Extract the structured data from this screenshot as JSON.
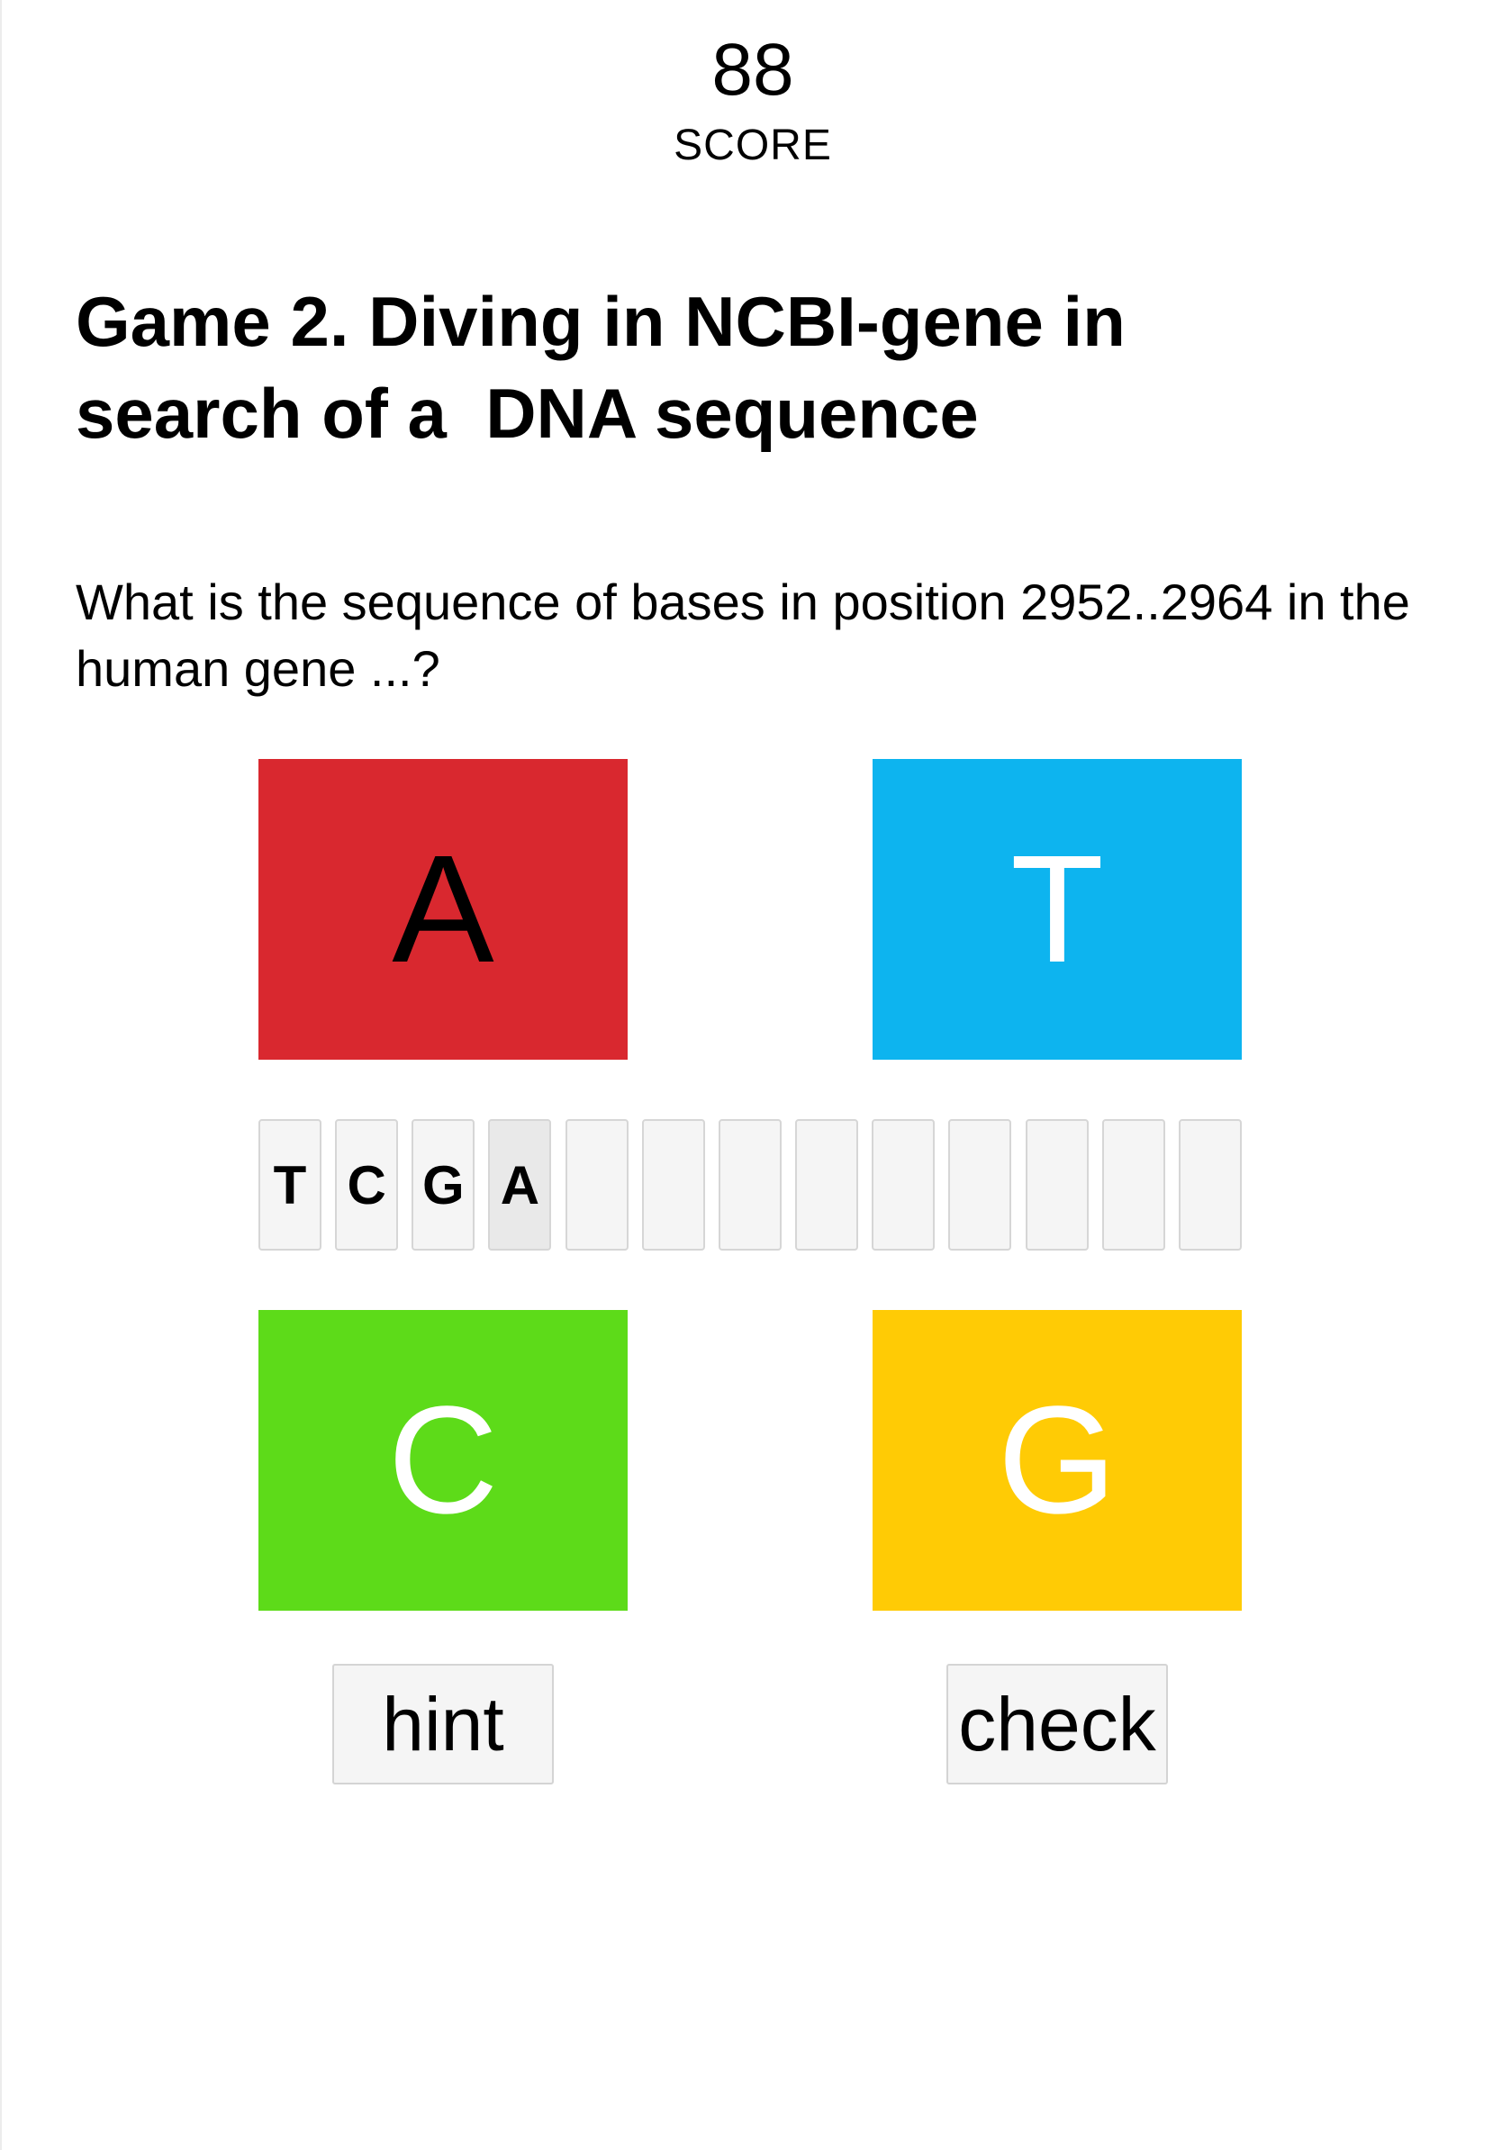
{
  "score": {
    "value": "88",
    "label": "SCORE"
  },
  "title": "Game 2. Diving in NCBI-gene in\nsearch of a  DNA sequence",
  "question": "What is the sequence of bases in position 2952..2964 in the human gene ...?",
  "tiles": [
    {
      "base": "A",
      "color": "#d9282f",
      "text_color": "#000000"
    },
    {
      "base": "T",
      "color": "#0db4ef",
      "text_color": "#ffffff"
    },
    {
      "base": "C",
      "color": "#5ddb19",
      "text_color": "#ffffff"
    },
    {
      "base": "G",
      "color": "#ffcb05",
      "text_color": "#ffffff"
    }
  ],
  "sequence": {
    "length": 13,
    "entered": [
      "T",
      "C",
      "G",
      "A"
    ],
    "active_index": 3
  },
  "buttons": {
    "hint": "hint",
    "check": "check"
  }
}
